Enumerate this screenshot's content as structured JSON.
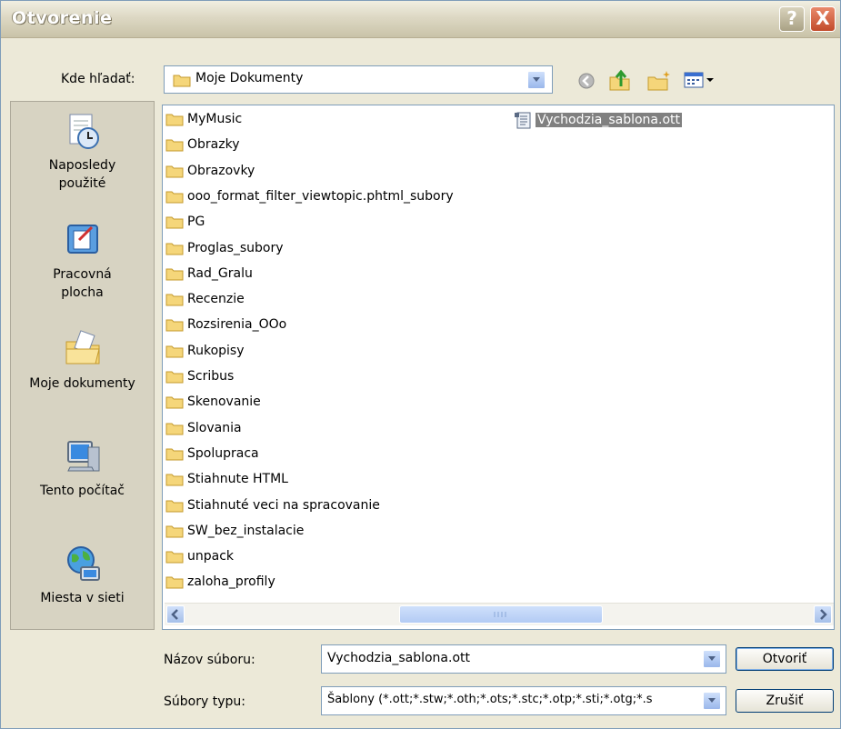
{
  "window": {
    "title": "Otvorenie",
    "help_label": "?",
    "close_label": "X"
  },
  "lookin": {
    "label": "Kde hľadať:",
    "value": "Moje Dokumenty"
  },
  "toolbar": {
    "icons": [
      "back-icon",
      "up-folder-icon",
      "new-folder-icon",
      "view-menu-icon"
    ]
  },
  "places": [
    {
      "label": "Naposledy použité",
      "icon": "recent-icon"
    },
    {
      "label": "Pracovná plocha",
      "icon": "desktop-icon"
    },
    {
      "label": "Moje dokumenty",
      "icon": "my-documents-icon"
    },
    {
      "label": "Tento počítač",
      "icon": "my-computer-icon"
    },
    {
      "label": "Miesta v sieti",
      "icon": "network-icon"
    }
  ],
  "folders": [
    "MyMusic",
    "Obrazky",
    "Obrazovky",
    "ooo_format_filter_viewtopic.phtml_subory",
    "PG",
    "Proglas_subory",
    "Rad_Gralu",
    "Recenzie",
    "Rozsirenia_OOo",
    "Rukopisy",
    "Scribus",
    "Skenovanie",
    "Slovania",
    "Spolupraca",
    "Stiahnute HTML",
    "Stiahnuté veci na spracovanie",
    "SW_bez_instalacie",
    "unpack",
    "zaloha_profily"
  ],
  "files": [
    {
      "name": "Vychodzia_sablona.ott",
      "selected": true
    }
  ],
  "filename": {
    "label": "Názov súboru:",
    "value": "Vychodzia_sablona.ott"
  },
  "filetype": {
    "label": "Súbory typu:",
    "value": "Šablony (*.ott;*.stw;*.oth;*.ots;*.stc;*.otp;*.sti;*.otg;*.s"
  },
  "buttons": {
    "open": "Otvoriť",
    "cancel": "Zrušiť"
  },
  "colors": {
    "selection": "#808080",
    "folder": "#f5d67a",
    "accent": "#316ac5"
  }
}
